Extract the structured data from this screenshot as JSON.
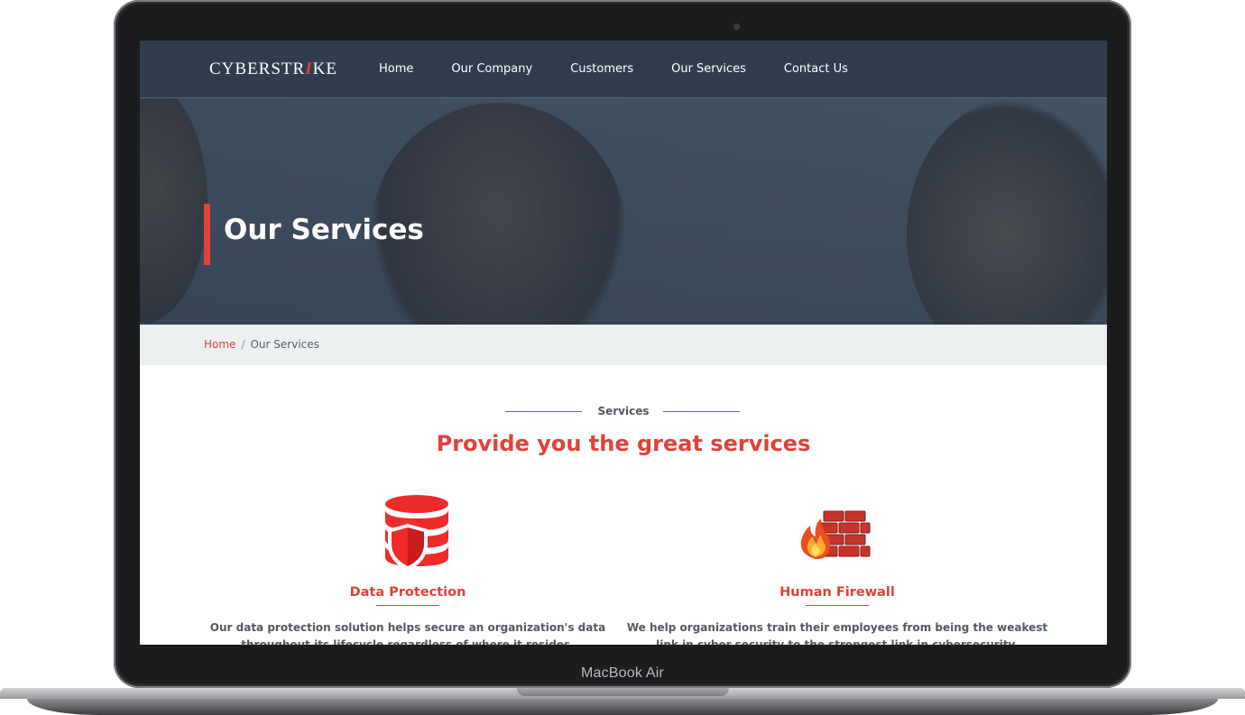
{
  "device": {
    "label": "MacBook Air"
  },
  "site": {
    "logo_text_a": "CYBERSTR",
    "logo_bolt": "I",
    "logo_text_b": "KE",
    "nav": [
      "Home",
      "Our Company",
      "Customers",
      "Our Services",
      "Contact Us"
    ]
  },
  "hero": {
    "title": "Our Services"
  },
  "breadcrumb": {
    "home": "Home",
    "separator": "/",
    "current": "Our Services"
  },
  "section": {
    "label": "Services",
    "heading": "Provide you the great services"
  },
  "cards": [
    {
      "title": "Data Protection",
      "icon": "database-shield-icon",
      "text": "Our data protection solution helps secure an organization's data throughout its lifecycle regardless of where it resides."
    },
    {
      "title": "Human Firewall",
      "icon": "firewall-icon",
      "text": "We help organizations train their employees from being the weakest link in cyber security to the strongest link in cybersecurity."
    }
  ],
  "colors": {
    "accent": "#e0423a",
    "navbar": "#2f3d4f",
    "crumb_bg": "#ecf0f1"
  }
}
